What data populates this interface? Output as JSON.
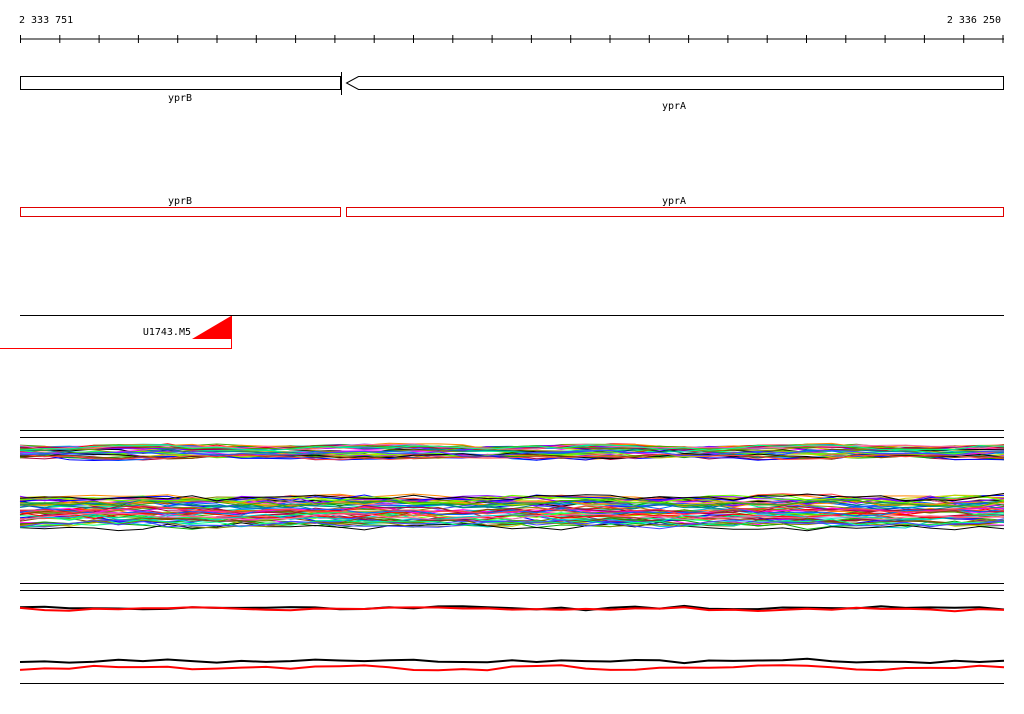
{
  "ruler": {
    "start_label": "2 333 751",
    "end_label": "2 336 250"
  },
  "genes": {
    "yprB_label": "yprB",
    "yprA_label": "yprA"
  },
  "cds": {
    "yprB_label": "yprB",
    "yprA_label": "yprA"
  },
  "feature": {
    "label": "U1743.M5",
    "color": "#ff0000"
  },
  "colors": {
    "accent": "#ff0000",
    "line": "#000000"
  }
}
